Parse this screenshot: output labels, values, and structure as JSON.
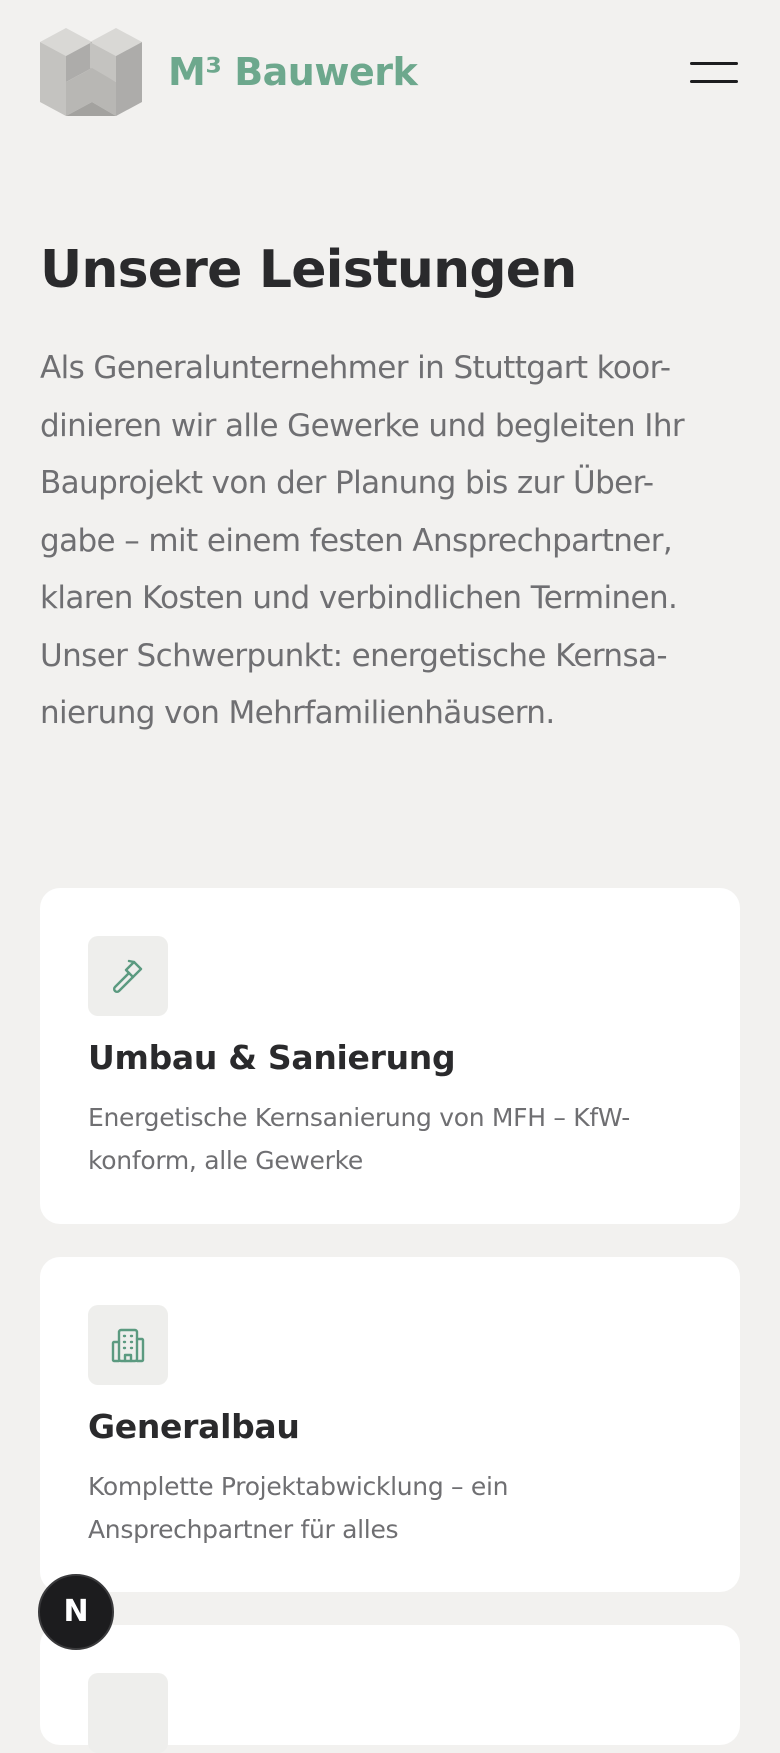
{
  "header": {
    "brand": "M³ Bauwerk",
    "logo_icon": "m3-cube-logo",
    "menu_icon": "hamburger-menu-icon"
  },
  "main": {
    "title": "Unsere Leistungen",
    "intro_lines": [
      "Als Generalunternehmer in Stuttgart koor-",
      "dinieren wir alle Gewerke und begleiten Ihr",
      "Bauprojekt von der Planung bis zur Über-",
      "gabe – mit einem festen Ansprechpartner,",
      "klaren Kosten und verbindlichen Terminen.",
      "Unser Schwerpunkt: energetische Kernsa-",
      "nierung von Mehrfamilienhäusern."
    ]
  },
  "services": [
    {
      "icon": "hammer-icon",
      "title": "Umbau & Sanierung",
      "description_lines": [
        "Energetische Kernsanierung von MFH – KfW-",
        "konform, alle Gewerke"
      ]
    },
    {
      "icon": "building-icon",
      "title": "Generalbau",
      "description_lines": [
        "Komplette Projektabwicklung – ein",
        "Ansprechpartner für alles"
      ]
    },
    {
      "icon": "service-icon",
      "title": "",
      "description_lines": []
    }
  ],
  "dev_badge": {
    "label": "N",
    "icon": "nextjs-dev-indicator-icon"
  },
  "colors": {
    "background": "#f2f1ef",
    "brand_green": "#6da88d",
    "icon_green": "#5b9a80",
    "card": "#ffffff",
    "text_dark": "#2a2a2c",
    "text_muted": "#6f6f72",
    "icon_tile": "#eeeeec"
  }
}
